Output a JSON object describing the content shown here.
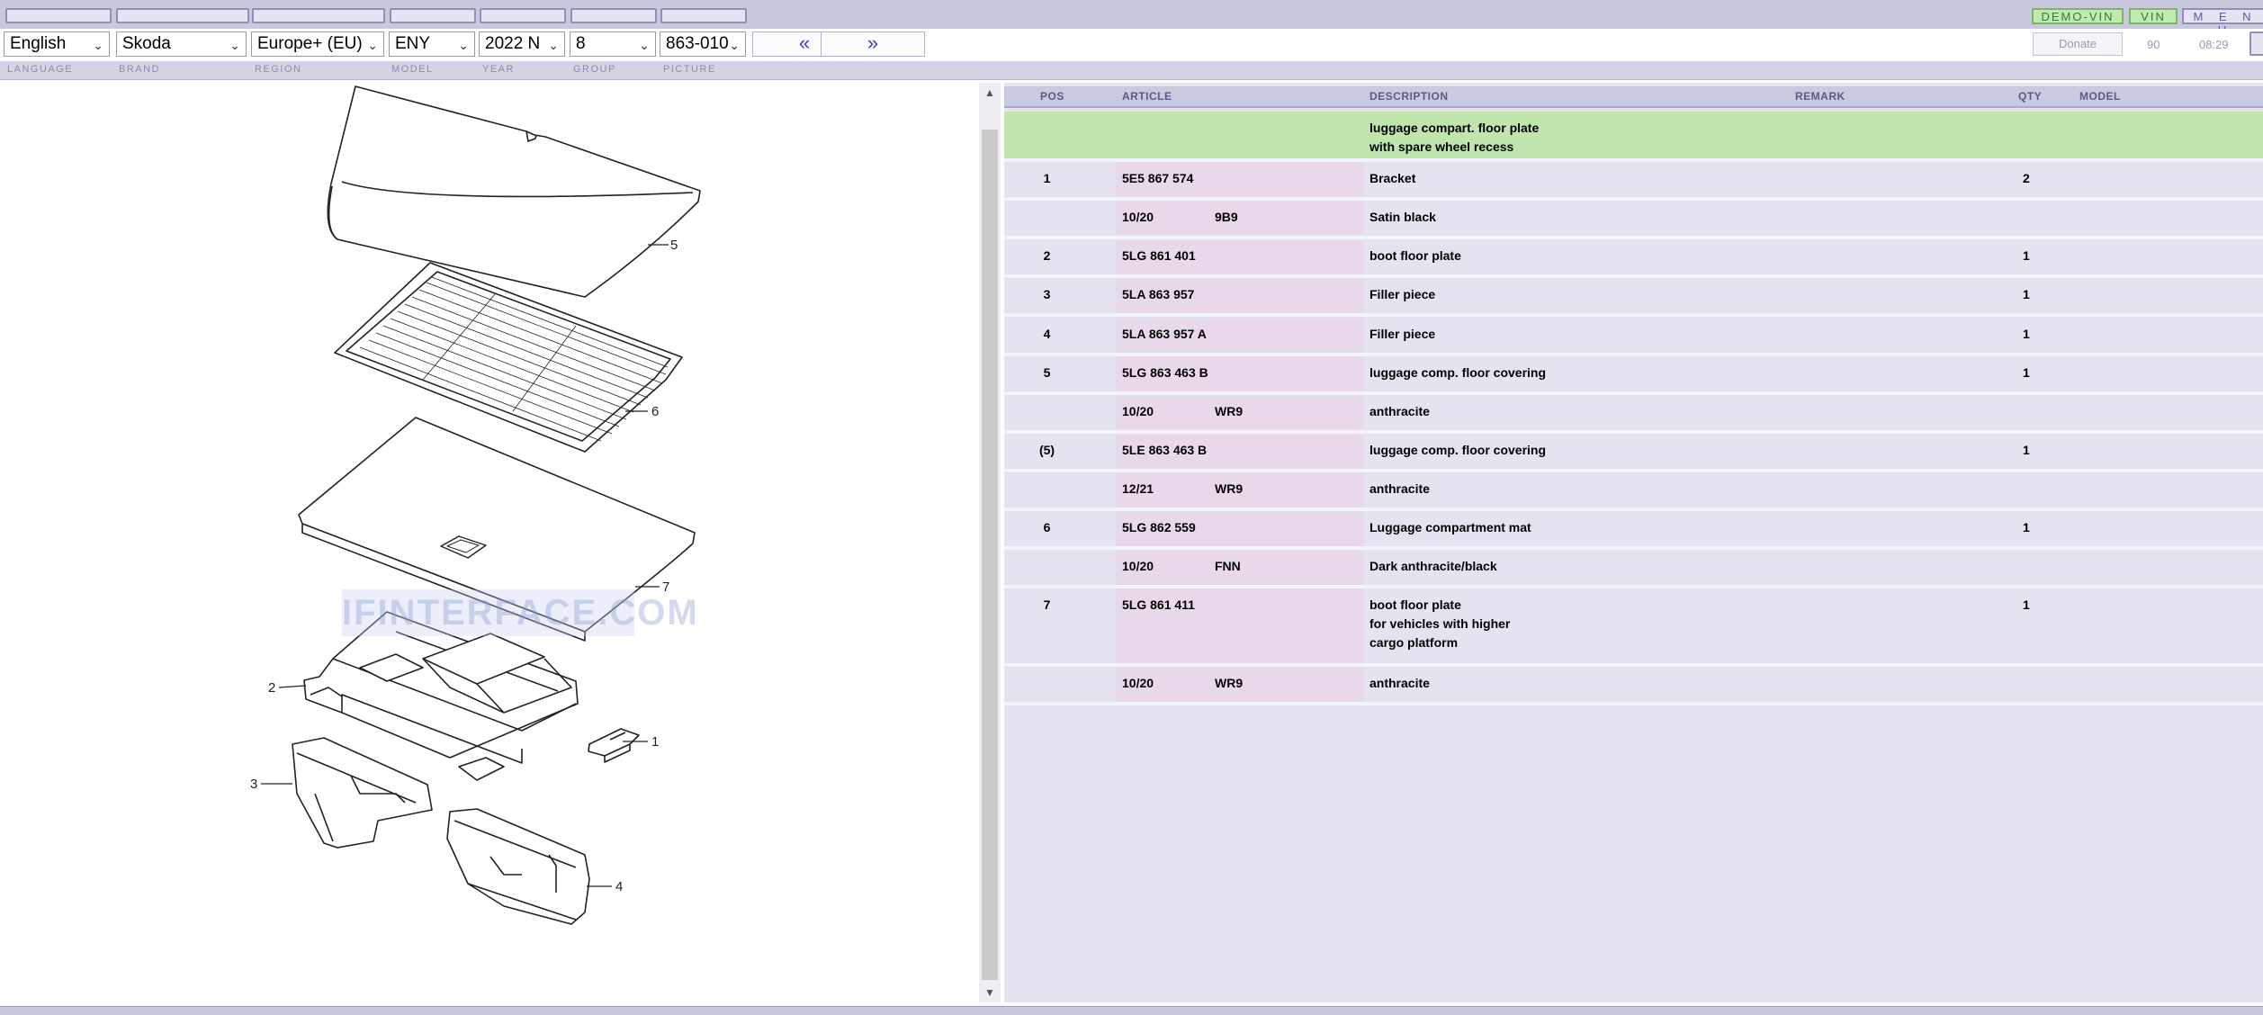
{
  "toolbar": {
    "demo_vin": "DEMO-VIN",
    "vin": "VIN",
    "menu": "M E N U",
    "donate": "Donate",
    "counter": "90",
    "time": "08:29",
    "prev": "«",
    "next": "»"
  },
  "selectors": {
    "language": "English",
    "brand": "Skoda",
    "region": "Europe+ (EU)",
    "model": "ENY",
    "year": "2022  N",
    "group": "8",
    "picture": "863-010"
  },
  "labels": {
    "language": "LANGUAGE",
    "brand": "BRAND",
    "region": "REGION",
    "model": "MODEL",
    "year": "YEAR",
    "group": "GROUP",
    "picture": "PICTURE"
  },
  "diagram": {
    "watermark": "IFINTERFACE.COM",
    "callouts": [
      "5",
      "6",
      "7",
      "2",
      "1",
      "3",
      "4"
    ]
  },
  "table": {
    "headers": {
      "pos": "POS",
      "article": "ARTICLE",
      "description": "DESCRIPTION",
      "remark": "REMARK",
      "qty": "QTY",
      "model": "MODEL"
    },
    "rows": [
      {
        "pos": "",
        "article": "",
        "code": "",
        "description": "luggage compart. floor plate\nwith spare wheel recess",
        "qty": "",
        "highlight": true
      },
      {
        "pos": "1",
        "article": "5E5 867 574",
        "code": "",
        "description": "Bracket",
        "qty": "2"
      },
      {
        "pos": "",
        "article": "10/20",
        "code": "9B9",
        "description": "Satin black",
        "qty": ""
      },
      {
        "pos": "2",
        "article": "5LG 861 401",
        "code": "",
        "description": "boot floor plate",
        "qty": "1"
      },
      {
        "pos": "3",
        "article": "5LA 863 957",
        "code": "",
        "description": "Filler piece",
        "qty": "1"
      },
      {
        "pos": "4",
        "article": "5LA 863 957 A",
        "code": "",
        "description": "Filler piece",
        "qty": "1"
      },
      {
        "pos": "5",
        "article": "5LG 863 463 B",
        "code": "",
        "description": "luggage comp. floor covering",
        "qty": "1"
      },
      {
        "pos": "",
        "article": "10/20",
        "code": "WR9",
        "description": "anthracite",
        "qty": ""
      },
      {
        "pos": "(5)",
        "article": "5LE 863 463 B",
        "code": "",
        "description": "luggage comp. floor covering",
        "qty": "1"
      },
      {
        "pos": "",
        "article": "12/21",
        "code": "WR9",
        "description": "anthracite",
        "qty": ""
      },
      {
        "pos": "6",
        "article": "5LG 862 559",
        "code": "",
        "description": "Luggage compartment mat",
        "qty": "1"
      },
      {
        "pos": "",
        "article": "10/20",
        "code": "FNN",
        "description": "Dark anthracite/black",
        "qty": ""
      },
      {
        "pos": "7",
        "article": "5LG 861 411",
        "code": "",
        "description": "boot floor plate\nfor vehicles with higher\ncargo platform",
        "qty": "1"
      },
      {
        "pos": "",
        "article": "10/20",
        "code": "WR9",
        "description": "anthracite",
        "qty": ""
      }
    ]
  }
}
